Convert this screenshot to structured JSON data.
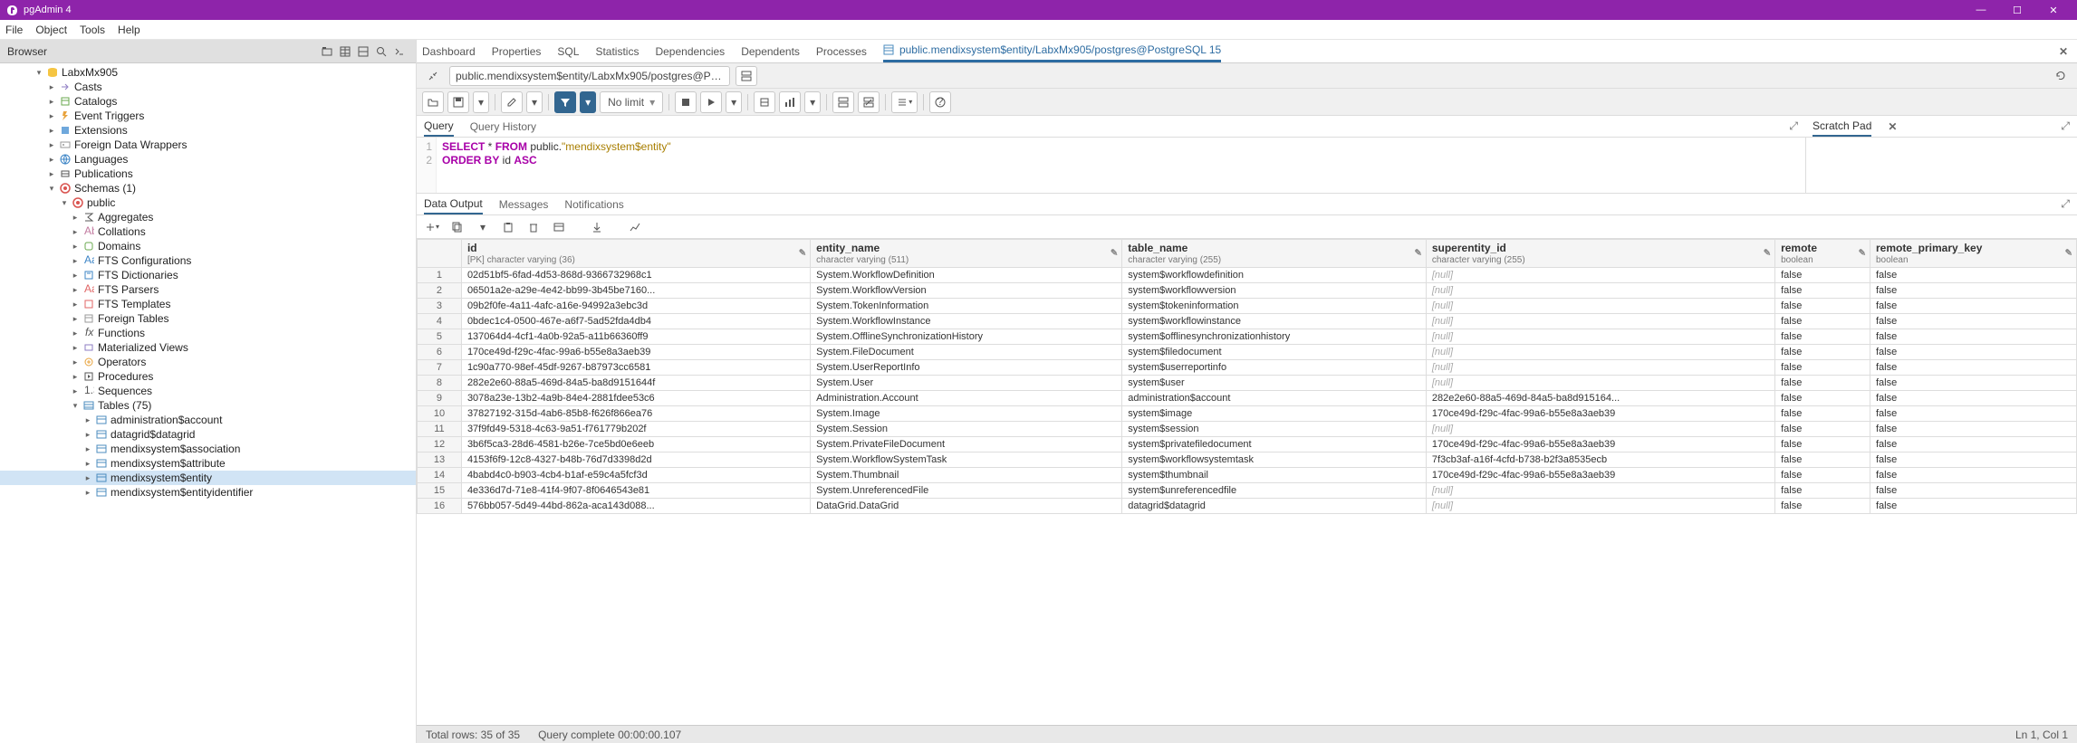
{
  "title": "pgAdmin 4",
  "menu": [
    "File",
    "Object",
    "Tools",
    "Help"
  ],
  "browser_label": "Browser",
  "tree": {
    "db": "LabxMx905",
    "items": [
      {
        "label": "Casts",
        "icon": "cast"
      },
      {
        "label": "Catalogs",
        "icon": "catalog"
      },
      {
        "label": "Event Triggers",
        "icon": "evt"
      },
      {
        "label": "Extensions",
        "icon": "ext"
      },
      {
        "label": "Foreign Data Wrappers",
        "icon": "fdw"
      },
      {
        "label": "Languages",
        "icon": "lang"
      },
      {
        "label": "Publications",
        "icon": "pub"
      },
      {
        "label": "Schemas (1)",
        "icon": "schema",
        "expanded": true
      }
    ],
    "schema": "public",
    "schema_items": [
      {
        "label": "Aggregates",
        "icon": "agg"
      },
      {
        "label": "Collations",
        "icon": "coll"
      },
      {
        "label": "Domains",
        "icon": "dom"
      },
      {
        "label": "FTS Configurations",
        "icon": "ftsc"
      },
      {
        "label": "FTS Dictionaries",
        "icon": "ftsd"
      },
      {
        "label": "FTS Parsers",
        "icon": "ftsp"
      },
      {
        "label": "FTS Templates",
        "icon": "ftst"
      },
      {
        "label": "Foreign Tables",
        "icon": "ftab"
      },
      {
        "label": "Functions",
        "icon": "func"
      },
      {
        "label": "Materialized Views",
        "icon": "mview"
      },
      {
        "label": "Operators",
        "icon": "oper"
      },
      {
        "label": "Procedures",
        "icon": "proc"
      },
      {
        "label": "Sequences",
        "icon": "seq"
      },
      {
        "label": "Tables (75)",
        "icon": "tables",
        "expanded": true
      }
    ],
    "tables": [
      "administration$account",
      "datagrid$datagrid",
      "mendixsystem$association",
      "mendixsystem$attribute",
      "mendixsystem$entity",
      "mendixsystem$entityidentifier"
    ],
    "selected_table": "mendixsystem$entity"
  },
  "top_tabs": [
    "Dashboard",
    "Properties",
    "SQL",
    "Statistics",
    "Dependencies",
    "Dependents",
    "Processes"
  ],
  "doc_tab": "public.mendixsystem$entity/LabxMx905/postgres@PostgreSQL 15",
  "query_path": "public.mendixsystem$entity/LabxMx905/postgres@PostgreSQ...",
  "nolimit": "No limit",
  "query_tabs": {
    "query": "Query",
    "history": "Query History"
  },
  "sql": {
    "line1_a": "SELECT",
    "line1_b": " * ",
    "line1_c": "FROM",
    "line1_d": " public.",
    "line1_e": "\"mendixsystem$entity\"",
    "line2_a": "ORDER BY",
    "line2_b": " id ",
    "line2_c": "ASC"
  },
  "scratch_label": "Scratch Pad",
  "results_tabs": {
    "data": "Data Output",
    "msg": "Messages",
    "notif": "Notifications"
  },
  "columns": [
    {
      "name": "id",
      "type": "[PK] character varying (36)"
    },
    {
      "name": "entity_name",
      "type": "character varying (511)"
    },
    {
      "name": "table_name",
      "type": "character varying (255)"
    },
    {
      "name": "superentity_id",
      "type": "character varying (255)"
    },
    {
      "name": "remote",
      "type": "boolean"
    },
    {
      "name": "remote_primary_key",
      "type": "boolean"
    }
  ],
  "rows": [
    [
      "02d51bf5-6fad-4d53-868d-9366732968c1",
      "System.WorkflowDefinition",
      "system$workflowdefinition",
      "[null]",
      "false",
      "false"
    ],
    [
      "06501a2e-a29e-4e42-bb99-3b45be7160...",
      "System.WorkflowVersion",
      "system$workflowversion",
      "[null]",
      "false",
      "false"
    ],
    [
      "09b2f0fe-4a11-4afc-a16e-94992a3ebc3d",
      "System.TokenInformation",
      "system$tokeninformation",
      "[null]",
      "false",
      "false"
    ],
    [
      "0bdec1c4-0500-467e-a6f7-5ad52fda4db4",
      "System.WorkflowInstance",
      "system$workflowinstance",
      "[null]",
      "false",
      "false"
    ],
    [
      "137064d4-4cf1-4a0b-92a5-a11b66360ff9",
      "System.OfflineSynchronizationHistory",
      "system$offlinesynchronizationhistory",
      "[null]",
      "false",
      "false"
    ],
    [
      "170ce49d-f29c-4fac-99a6-b55e8a3aeb39",
      "System.FileDocument",
      "system$filedocument",
      "[null]",
      "false",
      "false"
    ],
    [
      "1c90a770-98ef-45df-9267-b87973cc6581",
      "System.UserReportInfo",
      "system$userreportinfo",
      "[null]",
      "false",
      "false"
    ],
    [
      "282e2e60-88a5-469d-84a5-ba8d9151644f",
      "System.User",
      "system$user",
      "[null]",
      "false",
      "false"
    ],
    [
      "3078a23e-13b2-4a9b-84e4-2881fdee53c6",
      "Administration.Account",
      "administration$account",
      "282e2e60-88a5-469d-84a5-ba8d915164...",
      "false",
      "false"
    ],
    [
      "37827192-315d-4ab6-85b8-f626f866ea76",
      "System.Image",
      "system$image",
      "170ce49d-f29c-4fac-99a6-b55e8a3aeb39",
      "false",
      "false"
    ],
    [
      "37f9fd49-5318-4c63-9a51-f761779b202f",
      "System.Session",
      "system$session",
      "[null]",
      "false",
      "false"
    ],
    [
      "3b6f5ca3-28d6-4581-b26e-7ce5bd0e6eeb",
      "System.PrivateFileDocument",
      "system$privatefiledocument",
      "170ce49d-f29c-4fac-99a6-b55e8a3aeb39",
      "false",
      "false"
    ],
    [
      "4153f6f9-12c8-4327-b48b-76d7d3398d2d",
      "System.WorkflowSystemTask",
      "system$workflowsystemtask",
      "7f3cb3af-a16f-4cfd-b738-b2f3a8535ecb",
      "false",
      "false"
    ],
    [
      "4babd4c0-b903-4cb4-b1af-e59c4a5fcf3d",
      "System.Thumbnail",
      "system$thumbnail",
      "170ce49d-f29c-4fac-99a6-b55e8a3aeb39",
      "false",
      "false"
    ],
    [
      "4e336d7d-71e8-41f4-9f07-8f0646543e81",
      "System.UnreferencedFile",
      "system$unreferencedfile",
      "[null]",
      "false",
      "false"
    ],
    [
      "576bb057-5d49-44bd-862a-aca143d088...",
      "DataGrid.DataGrid",
      "datagrid$datagrid",
      "[null]",
      "false",
      "false"
    ]
  ],
  "status": {
    "total": "Total rows: 35 of 35",
    "time": "Query complete 00:00:00.107",
    "pos": "Ln 1, Col 1"
  }
}
